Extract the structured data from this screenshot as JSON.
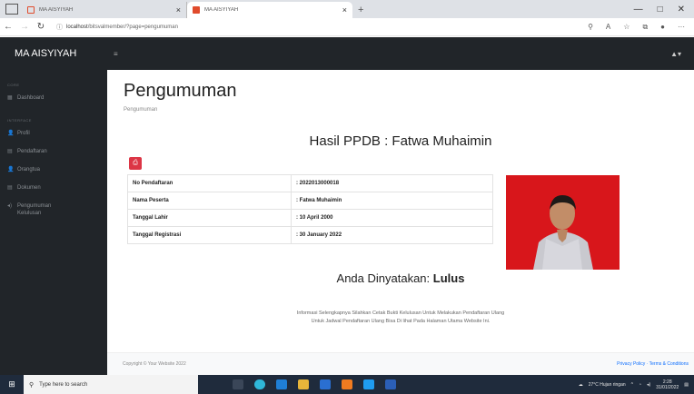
{
  "browser": {
    "tabs": [
      {
        "title": "MA AISYIYAH",
        "active": false
      },
      {
        "title": "MA AISYIYAH",
        "active": true
      }
    ],
    "new_tab": "+",
    "url_host": "localhost",
    "url_path": "/bitsvalmember/?page=pengumuman"
  },
  "nav": {
    "brand": "MA AISYIYAH",
    "burger": "≡",
    "user": "▲▾"
  },
  "sidebar": {
    "heading_core": "CORE",
    "heading_interface": "INTERFACE",
    "items": [
      {
        "icon": "▦",
        "label": "Dashboard"
      },
      {
        "icon": "👤",
        "label": "Profil"
      },
      {
        "icon": "▤",
        "label": "Pendaftaran"
      },
      {
        "icon": "👤",
        "label": "Orangtua"
      },
      {
        "icon": "▤",
        "label": "Dokumen"
      },
      {
        "icon": "◂)",
        "label": "Pengumuman Kelulusan"
      }
    ]
  },
  "page": {
    "title": "Pengumuman",
    "breadcrumb": "Pengumuman",
    "headline": "Hasil PPDB : Fatwa Muhaimin",
    "print_icon": "⎙",
    "rows": [
      {
        "label": "No Pendaftaran",
        "value": ": 2022013000018"
      },
      {
        "label": "Nama Peserta",
        "value": ": Fatwa Muhaimin"
      },
      {
        "label": "Tanggal Lahir",
        "value": ": 10 April 2000"
      },
      {
        "label": "Tanggal Registrasi",
        "value": ": 30 January 2022"
      }
    ],
    "result_prefix": "Anda Dinyatakan:",
    "result_status": "Lulus",
    "note_line1": "Informasi Selengkapnya Silahkan Cetak Bukti Kelulusan Untuk Melakukan Pendaftaran Ulang",
    "note_line2": "Untuk Jadwal Pendaftaran Ulang Bisa Di lihat Pada Halaman Utama Website Ini."
  },
  "footer": {
    "copyright": "Copyright © Your Website 2022",
    "links": "Privacy Policy · Terms & Conditions"
  },
  "taskbar": {
    "search_placeholder": "Type here to search",
    "weather": "27°C Hujan ringan",
    "time": "2:28",
    "date": "31/01/2022"
  },
  "colors": {
    "sidebar_bg": "#212529",
    "accent_red": "#dc3545",
    "photo_bg": "#d8161b"
  }
}
